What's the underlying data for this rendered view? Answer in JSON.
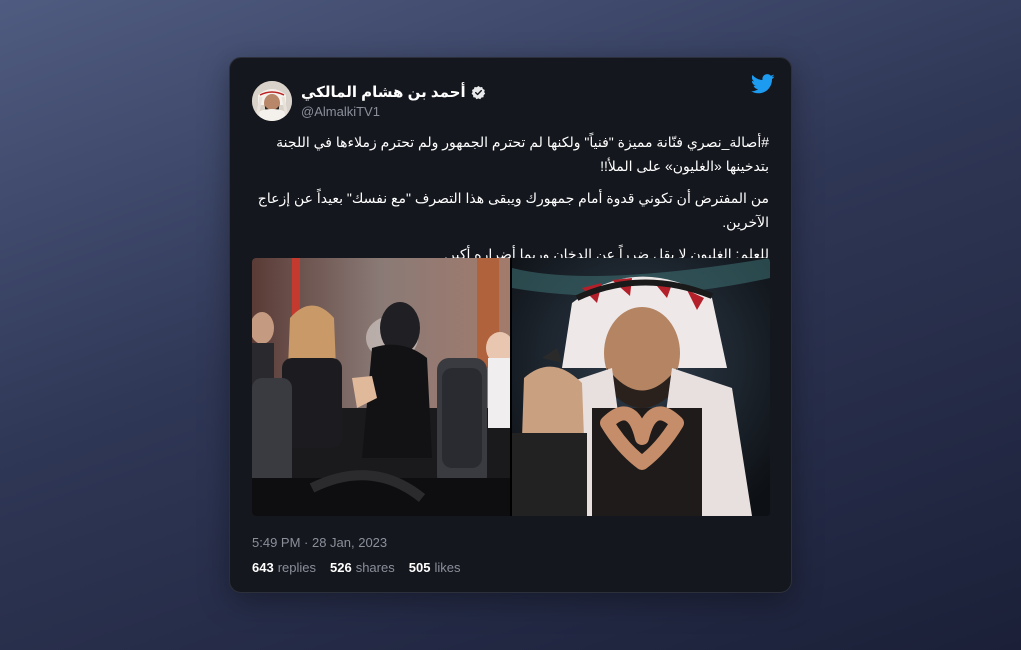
{
  "tweet": {
    "author": {
      "display_name": "أحمد بن هشام المالكي",
      "handle": "@AlmalkiTV1",
      "verified": true,
      "avatar_icon": "profile-photo"
    },
    "brand_icon": "twitter-bird-icon",
    "brand_color": "#1d9bf0",
    "text": {
      "paragraph_1": "#أصالة_نصري فنّانة مميزة \"فنياً\" ولكنها لم تحترم الجمهور ولم تحترم زملاءها في اللجنة بتدخينها «الغليون» على الملأ!!",
      "paragraph_2": "من المفترض أن تكوني قدوة أمام جمهورك ويبقى هذا التصرف \"مع نفسك\" بعيداً عن إزعاج الآخرين.",
      "paragraph_3": "للعلم: الغليون لا يقل ضرراً عن الدخان وربما أضراره أكبر."
    },
    "media": [
      {
        "description_icon": "judges-panel-photo"
      },
      {
        "description_icon": "man-heart-hands-photo"
      }
    ],
    "timestamp": "5:49 PM · 28 Jan, 2023",
    "stats": {
      "replies_count": "643",
      "replies_label": "replies",
      "shares_count": "526",
      "shares_label": "shares",
      "likes_count": "505",
      "likes_label": "likes"
    }
  }
}
